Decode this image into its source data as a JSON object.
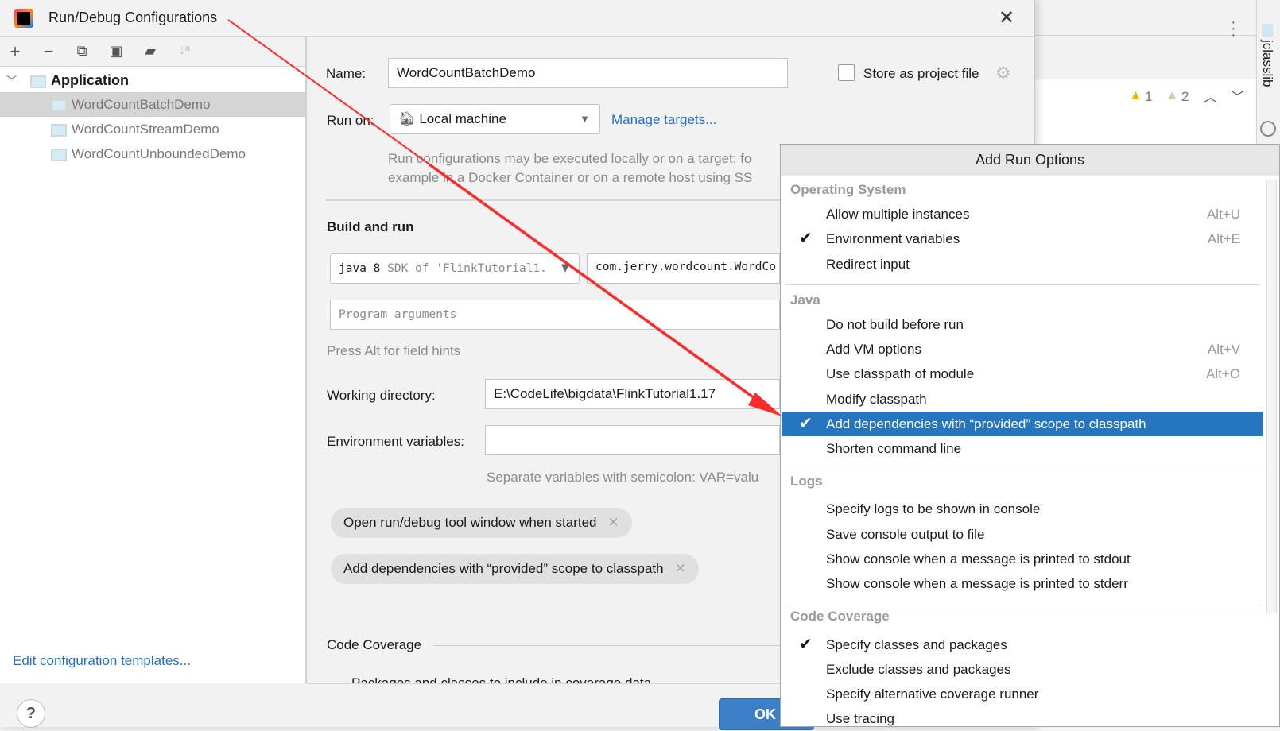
{
  "dialog": {
    "title": "Run/Debug Configurations",
    "close_icon": "close-icon"
  },
  "toolbar": {
    "icons": [
      "plus-icon",
      "minus-icon",
      "copy-icon",
      "save-icon",
      "new-folder-icon",
      "sort-alpha-icon"
    ]
  },
  "tree": {
    "group": "Application",
    "items": [
      {
        "label": "WordCountBatchDemo",
        "selected": true
      },
      {
        "label": "WordCountStreamDemo"
      },
      {
        "label": "WordCountUnboundedDemo"
      }
    ]
  },
  "left_footer": {
    "link": "Edit configuration templates...",
    "help": "?"
  },
  "form": {
    "name_label": "Name:",
    "name_value": "WordCountBatchDemo",
    "store_label": "Store as project file",
    "store_checked": false,
    "runon_label": "Run on:",
    "runon_value": "Local machine",
    "manage_targets": "Manage targets...",
    "runon_desc1": "Run configurations may be executed locally or on a target: fo",
    "runon_desc2": "example in a Docker Container or on a remote host using SS",
    "build_title": "Build and run",
    "jdk_main": "java 8",
    "jdk_hint": "SDK of 'FlinkTutorial1.",
    "main_class": "com.jerry.wordcount.WordCo",
    "program_args_placeholder": "Program arguments",
    "alt_hint": "Press Alt for field hints",
    "workdir_label": "Working directory:",
    "workdir_value": "E:\\CodeLife\\bigdata\\FlinkTutorial1.17",
    "env_label": "Environment variables:",
    "env_value": "",
    "env_hint": "Separate variables with semicolon: VAR=valu",
    "chips": [
      "Open run/debug tool window when started",
      "Add dependencies with “provided” scope to classpath"
    ],
    "coverage_title": "Code Coverage",
    "coverage_sub": "Packages and classes to include in coverage data",
    "ok": "OK"
  },
  "ide": {
    "warn1": "1",
    "warn2": "2",
    "side_tab": "jclasslib"
  },
  "popup": {
    "title": "Add Run Options",
    "groups": [
      {
        "name": "Operating System",
        "items": [
          {
            "label": "Allow multiple instances",
            "shortcut": "Alt+U"
          },
          {
            "label": "Environment variables",
            "shortcut": "Alt+E",
            "checked": true
          },
          {
            "label": "Redirect input"
          }
        ]
      },
      {
        "name": "Java",
        "items": [
          {
            "label": "Do not build before run"
          },
          {
            "label": "Add VM options",
            "shortcut": "Alt+V"
          },
          {
            "label": "Use classpath of module",
            "shortcut": "Alt+O"
          },
          {
            "label": "Modify classpath"
          },
          {
            "label": "Add dependencies with “provided” scope to classpath",
            "checked": true,
            "highlighted": true
          },
          {
            "label": "Shorten command line"
          }
        ]
      },
      {
        "name": "Logs",
        "items": [
          {
            "label": "Specify logs to be shown in console"
          },
          {
            "label": "Save console output to file"
          },
          {
            "label": "Show console when a message is printed to stdout"
          },
          {
            "label": "Show console when a message is printed to stderr"
          }
        ]
      },
      {
        "name": "Code Coverage",
        "items": [
          {
            "label": "Specify classes and packages",
            "checked": true
          },
          {
            "label": "Exclude classes and packages"
          },
          {
            "label": "Specify alternative coverage runner"
          },
          {
            "label": "Use tracing"
          }
        ]
      }
    ]
  },
  "colors": {
    "accent": "#2675bf",
    "link": "#2470c0",
    "annotation_arrow": "#ff2a2a"
  }
}
